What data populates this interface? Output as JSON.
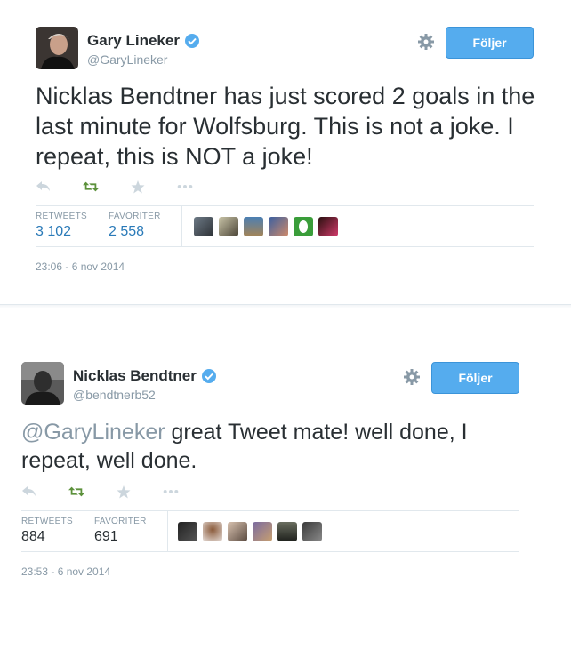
{
  "tweets": [
    {
      "name": "Gary Lineker",
      "handle": "@GaryLineker",
      "follow_label": "Följer",
      "text": "Nicklas Bendtner has just scored 2 goals in the last minute for Wolfsburg. This is not a joke. I repeat, this is NOT a joke!",
      "retweets_label": "RETWEETS",
      "retweets": "3 102",
      "favorites_label": "FAVORITER",
      "favorites": "2 558",
      "timestamp": "23:06 - 6 nov 2014"
    },
    {
      "name": "Nicklas Bendtner",
      "handle": "@bendtnerb52",
      "follow_label": "Följer",
      "mention": "@GaryLineker",
      "text": " great Tweet mate! well done, I repeat, well done.",
      "retweets_label": "RETWEETS",
      "retweets": "884",
      "favorites_label": "FAVORITER",
      "favorites": "691",
      "timestamp": "23:53 - 6 nov 2014"
    }
  ],
  "icons": [
    "verified-icon",
    "gear-icon",
    "reply-icon",
    "retweet-icon",
    "favorite-icon",
    "more-icon"
  ],
  "colors": {
    "follow_button": "#55acee",
    "verified": "#55acee",
    "retweet_green": "#5c913b",
    "stat_value_blue": "#2a7ab8",
    "muted_text": "#8899a6"
  }
}
